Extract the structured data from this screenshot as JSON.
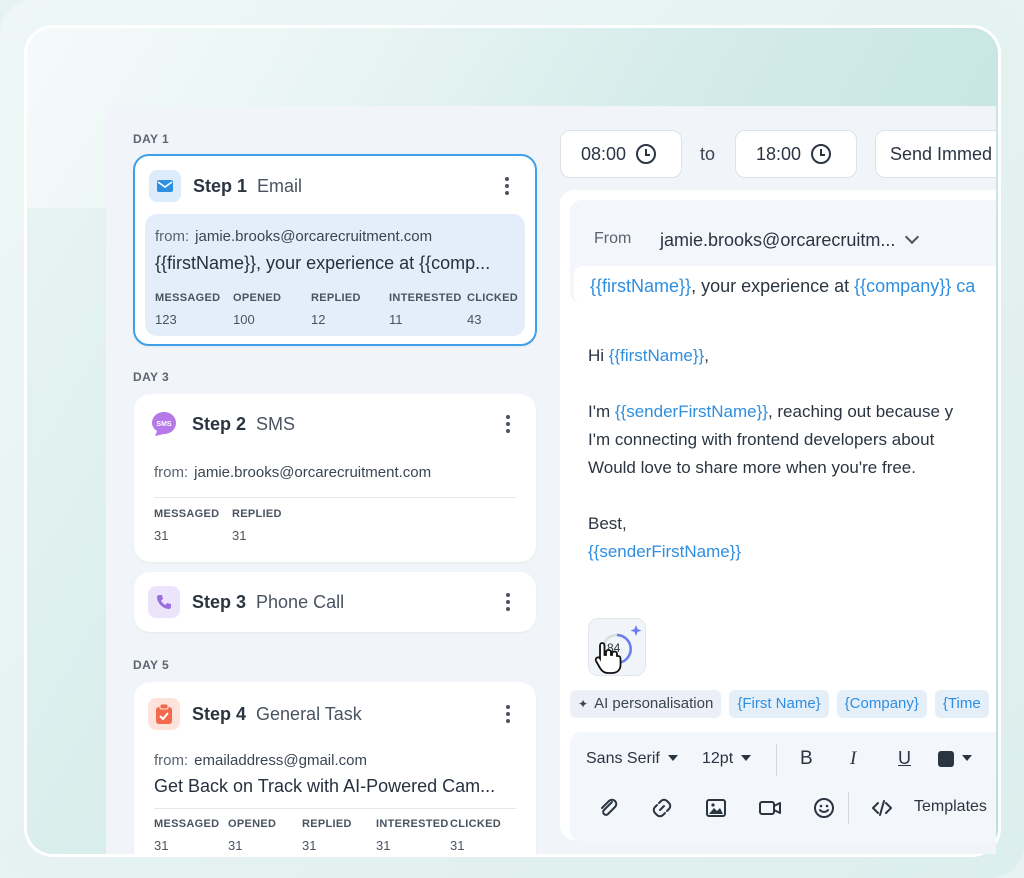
{
  "steps": [
    {
      "day": "DAY 1",
      "num": "Step 1",
      "type": "Email",
      "from_label": "from:",
      "from": "jamie.brooks@orcarecruitment.com",
      "subject": "{{firstName}}, your experience at {{comp...",
      "stats": [
        {
          "label": "MESSAGED",
          "value": "123"
        },
        {
          "label": "OPENED",
          "value": "100"
        },
        {
          "label": "REPLIED",
          "value": "12"
        },
        {
          "label": "INTERESTED",
          "value": "11"
        },
        {
          "label": "CLICKED",
          "value": "43"
        }
      ]
    },
    {
      "day": "DAY 3",
      "num": "Step 2",
      "type": "SMS",
      "from_label": "from:",
      "from": "jamie.brooks@orcarecruitment.com",
      "stats": [
        {
          "label": "MESSAGED",
          "value": "31"
        },
        {
          "label": "REPLIED",
          "value": "31"
        }
      ]
    },
    {
      "num": "Step 3",
      "type": "Phone Call"
    },
    {
      "day": "DAY 5",
      "num": "Step 4",
      "type": "General Task",
      "from_label": "from:",
      "from": "emailaddress@gmail.com",
      "subject": "Get Back on Track with AI-Powered Cam...",
      "stats": [
        {
          "label": "MESSAGED",
          "value": "31"
        },
        {
          "label": "OPENED",
          "value": "31"
        },
        {
          "label": "REPLIED",
          "value": "31"
        },
        {
          "label": "INTERESTED",
          "value": "31"
        },
        {
          "label": "CLICKED",
          "value": "31"
        }
      ]
    }
  ],
  "schedule": {
    "start": "08:00",
    "to": "to",
    "end": "18:00",
    "send": "Send Immed"
  },
  "editor": {
    "from_label": "From",
    "from_value": "jamie.brooks@orcarecruitm...",
    "subject_var1": "{{firstName}}",
    "subject_mid": ", your experience at ",
    "subject_var2": "{{company}}",
    "subject_end": " ca",
    "greeting": "Hi ",
    "greeting_var": "{{firstName}}",
    "greeting_end": ",",
    "line1_start": "I'm ",
    "line1_var": "{{senderFirstName}}",
    "line1_end": ", reaching out because y",
    "line2": "I'm connecting with frontend developers about",
    "line3": "Would love to share more when you're free.",
    "signoff": "Best,",
    "signature_var": "{{senderFirstName}}",
    "ai_score": "84"
  },
  "chips": {
    "ai": "AI personalisation",
    "first_name": "{First Name}",
    "company": "{Company}",
    "time": "{Time"
  },
  "toolbar": {
    "font": "Sans Serif",
    "size": "12pt",
    "bold": "B",
    "italic": "I",
    "underline": "U",
    "templates": "Templates"
  },
  "colors": {
    "accent": "#2e8ee0",
    "email_icon_bg": "#dcecfb",
    "sms_icon": "#b57ae8",
    "phone_icon_bg": "#ece4fb",
    "task_icon": "#f26a4b"
  }
}
